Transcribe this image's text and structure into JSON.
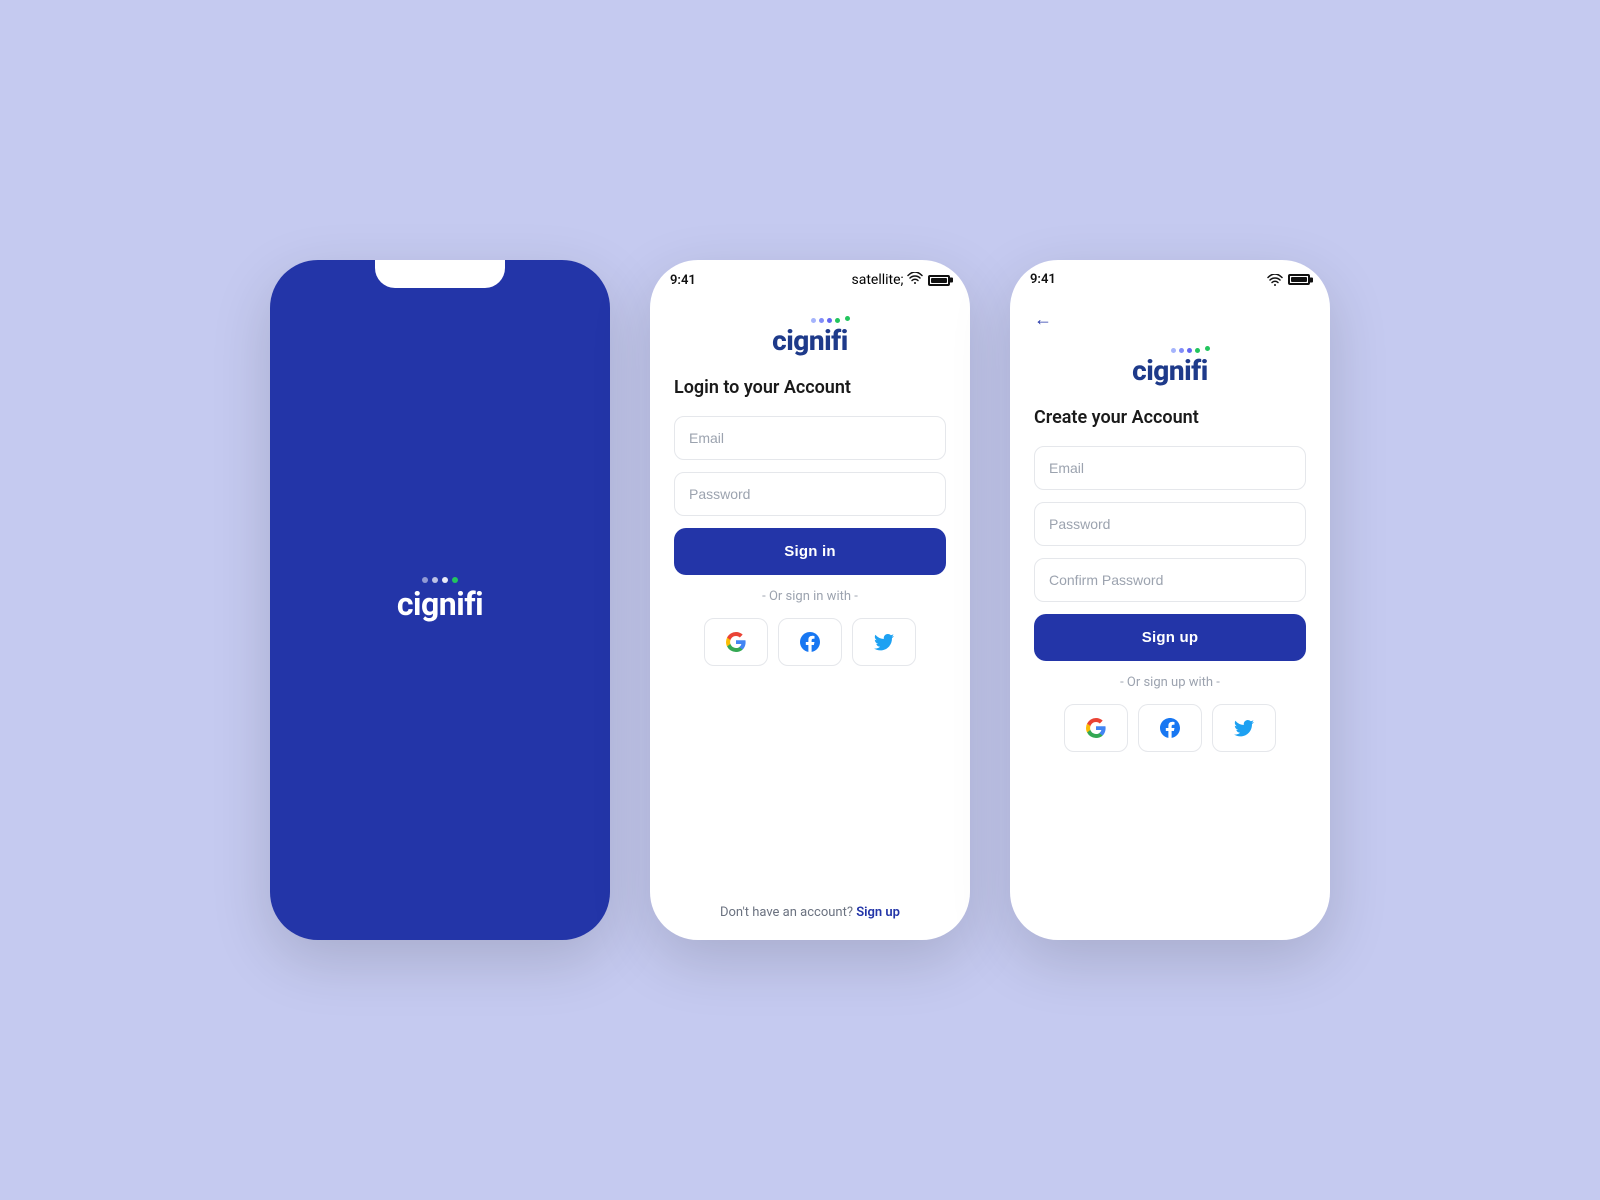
{
  "colors": {
    "brand_blue": "#2335a8",
    "background": "#c5caf0",
    "text_dark": "#1a1a1a",
    "text_gray": "#9ca3af",
    "border": "#e5e7eb",
    "green_dot": "#22c55e"
  },
  "splash": {
    "logo_text": "cignifi"
  },
  "login_screen": {
    "status_time": "9:41",
    "title": "Login to your Account",
    "email_placeholder": "Email",
    "password_placeholder": "Password",
    "sign_in_label": "Sign in",
    "or_divider": "- Or sign in with -",
    "footer_text": "Don't have an account?",
    "footer_link": "Sign up"
  },
  "signup_screen": {
    "status_time": "9:41",
    "title": "Create your Account",
    "email_placeholder": "Email",
    "password_placeholder": "Password",
    "confirm_password_placeholder": "Confirm Password",
    "sign_up_label": "Sign up",
    "or_divider": "- Or sign up with -"
  }
}
